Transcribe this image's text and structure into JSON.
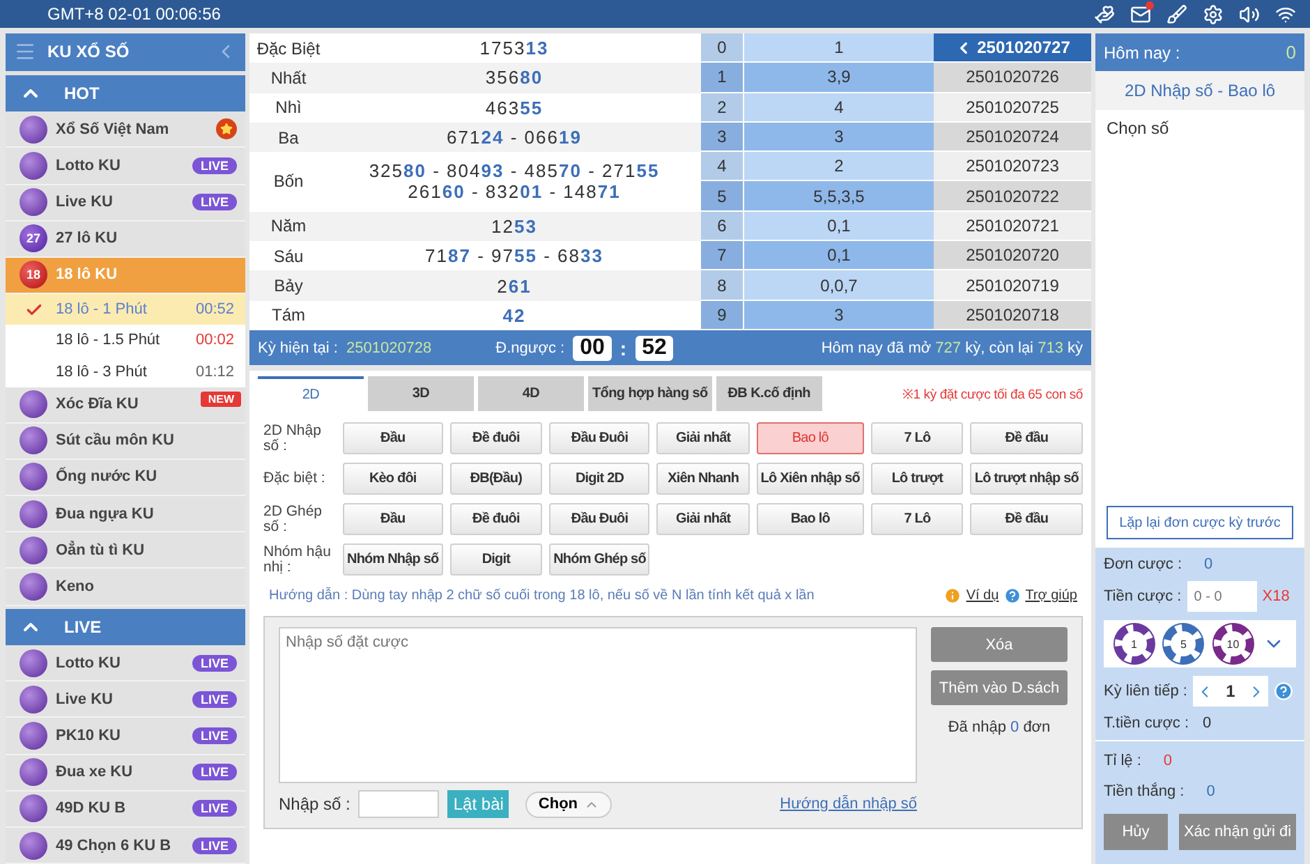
{
  "topbar": {
    "clock": "GMT+8 02-01 00:06:56",
    "mail_unread": true
  },
  "sidebar": {
    "title": "KU XỔ SỐ",
    "sections": [
      {
        "title": "HOT",
        "expanded": true,
        "items": [
          {
            "label": "Xổ Số Việt Nam",
            "starred": true,
            "selected": false
          },
          {
            "label": "Lotto KU",
            "badge": "LIVE",
            "selected": false
          },
          {
            "label": "Live KU",
            "badge": "LIVE",
            "selected": false
          },
          {
            "label": "27 lô KU",
            "icon_text": "27",
            "selected": false
          },
          {
            "label": "18 lô KU",
            "icon_text": "18",
            "selected": true,
            "expanded": true,
            "children": [
              {
                "label": "18 lô - 1 Phút",
                "time": "00:52",
                "color": "#5b7fd0",
                "selected": true
              },
              {
                "label": "18 lô - 1.5 Phút",
                "time": "00:02",
                "color": "#e53935",
                "selected": false
              },
              {
                "label": "18 lô - 3 Phút",
                "time": "01:12",
                "color": "#666666",
                "selected": false
              }
            ]
          },
          {
            "label": "Xóc Đĩa KU",
            "ribbon": "NEW",
            "selected": false
          },
          {
            "label": "Sút cầu môn KU",
            "selected": false
          },
          {
            "label": "Ống nước KU",
            "selected": false
          },
          {
            "label": "Đua ngựa KU",
            "selected": false
          },
          {
            "label": "Oẳn tù tì KU",
            "selected": false
          },
          {
            "label": "Keno",
            "selected": false
          }
        ]
      },
      {
        "title": "LIVE",
        "expanded": true,
        "items": [
          {
            "label": "Lotto KU",
            "badge": "LIVE",
            "selected": false
          },
          {
            "label": "Live KU",
            "badge": "LIVE",
            "selected": false
          },
          {
            "label": "PK10 KU",
            "badge": "LIVE",
            "selected": false
          },
          {
            "label": "Đua xe KU",
            "badge": "LIVE",
            "selected": false
          },
          {
            "label": "49D KU B",
            "badge": "LIVE",
            "selected": false
          },
          {
            "label": "49 Chọn 6 KU B",
            "badge": "LIVE",
            "selected": false
          }
        ]
      }
    ]
  },
  "results": {
    "prizes": [
      {
        "name": "Đặc Biệt",
        "lines": [
          [
            {
              "head": "1753",
              "tail": "13"
            }
          ]
        ]
      },
      {
        "name": "Nhất",
        "lines": [
          [
            {
              "head": "356",
              "tail": "80"
            }
          ]
        ]
      },
      {
        "name": "Nhì",
        "lines": [
          [
            {
              "head": "463",
              "tail": "55"
            }
          ]
        ]
      },
      {
        "name": "Ba",
        "lines": [
          [
            {
              "head": "671",
              "tail": "24"
            },
            {
              "head": "066",
              "tail": "19"
            }
          ]
        ]
      },
      {
        "name": "Bốn",
        "lines": [
          [
            {
              "head": "325",
              "tail": "80"
            },
            {
              "head": "804",
              "tail": "93"
            },
            {
              "head": "485",
              "tail": "70"
            },
            {
              "head": "271",
              "tail": "55"
            }
          ],
          [
            {
              "head": "261",
              "tail": "60"
            },
            {
              "head": "832",
              "tail": "01"
            },
            {
              "head": "148",
              "tail": "71"
            }
          ]
        ]
      },
      {
        "name": "Năm",
        "lines": [
          [
            {
              "head": "12",
              "tail": "53"
            }
          ]
        ]
      },
      {
        "name": "Sáu",
        "lines": [
          [
            {
              "head": "71",
              "tail": "87"
            },
            {
              "head": "97",
              "tail": "55"
            },
            {
              "head": "68",
              "tail": "33"
            }
          ]
        ]
      },
      {
        "name": "Bảy",
        "lines": [
          [
            {
              "head": "2",
              "tail": "61"
            }
          ]
        ]
      },
      {
        "name": "Tám",
        "lines": [
          [
            {
              "tail": "42"
            }
          ]
        ]
      }
    ],
    "separator": "-",
    "digits": [
      {
        "digit": "0",
        "values": "1"
      },
      {
        "digit": "1",
        "values": "3,9"
      },
      {
        "digit": "2",
        "values": "4"
      },
      {
        "digit": "3",
        "values": "3"
      },
      {
        "digit": "4",
        "values": "2"
      },
      {
        "digit": "5",
        "values": "5,5,3,5"
      },
      {
        "digit": "6",
        "values": "0,1"
      },
      {
        "digit": "7",
        "values": "0,1"
      },
      {
        "digit": "8",
        "values": "0,0,7"
      },
      {
        "digit": "9",
        "values": "3"
      }
    ],
    "periods": [
      {
        "label": "2501020727",
        "selected": true
      },
      {
        "label": "2501020726",
        "selected": false
      },
      {
        "label": "2501020725",
        "selected": false
      },
      {
        "label": "2501020724",
        "selected": false
      },
      {
        "label": "2501020723",
        "selected": false
      },
      {
        "label": "2501020722",
        "selected": false
      },
      {
        "label": "2501020721",
        "selected": false
      },
      {
        "label": "2501020720",
        "selected": false
      },
      {
        "label": "2501020719",
        "selected": false
      },
      {
        "label": "2501020718",
        "selected": false
      }
    ],
    "status": {
      "current_label": "Kỳ hiện tại  :",
      "current": "2501020728",
      "countdown_label": "Đ.ngược :",
      "minutes": "00",
      "colon": ":",
      "seconds": "52",
      "today_prefix": "Hôm nay đã mở",
      "opened": "727",
      "mid": "kỳ, còn lại",
      "remaining": "713",
      "suffix": "kỳ"
    }
  },
  "bet": {
    "tabs": [
      {
        "label": "2D",
        "selected": true
      },
      {
        "label": "3D",
        "selected": false
      },
      {
        "label": "4D",
        "selected": false
      },
      {
        "label": "Tổng hợp hàng số",
        "selected": false
      },
      {
        "label": "ĐB K.cố định",
        "selected": false
      }
    ],
    "notice": "※1 kỳ đặt cược tối đa 65 con số",
    "rows": [
      {
        "label": "2D Nhập số :",
        "buttons": [
          {
            "label": "Đầu",
            "selected": false
          },
          {
            "label": "Đề đuôi",
            "selected": false
          },
          {
            "label": "Đầu Đuôi",
            "selected": false
          },
          {
            "label": "Giải nhất",
            "selected": false
          },
          {
            "label": "Bao lô",
            "selected": true
          },
          {
            "label": "7 Lô",
            "selected": false
          },
          {
            "label": "Đề đầu",
            "selected": false
          }
        ]
      },
      {
        "label": "Đặc biệt :",
        "buttons": [
          {
            "label": "Kèo đôi",
            "selected": false
          },
          {
            "label": "ĐB(Đầu)",
            "selected": false
          },
          {
            "label": "Digit 2D",
            "selected": false
          },
          {
            "label": "Xiên Nhanh",
            "selected": false
          },
          {
            "label": "Lô Xiên nhập số",
            "selected": false
          },
          {
            "label": "Lô trượt",
            "selected": false
          },
          {
            "label": "Lô trượt nhập số",
            "selected": false
          }
        ]
      },
      {
        "label": "2D Ghép số :",
        "buttons": [
          {
            "label": "Đầu",
            "selected": false
          },
          {
            "label": "Đề đuôi",
            "selected": false
          },
          {
            "label": "Đầu Đuôi",
            "selected": false
          },
          {
            "label": "Giải nhất",
            "selected": false
          },
          {
            "label": "Bao lô",
            "selected": false
          },
          {
            "label": "7 Lô",
            "selected": false
          },
          {
            "label": "Đề đầu",
            "selected": false
          }
        ]
      },
      {
        "label": "Nhóm hậu nhị :",
        "buttons": [
          {
            "label": "Nhóm Nhập số",
            "selected": false
          },
          {
            "label": "Digit",
            "selected": false
          },
          {
            "label": "Nhóm Ghép số",
            "selected": false
          }
        ]
      }
    ],
    "guide": "Hướng dẫn : Dùng tay nhập 2 chữ số cuối trong 18 lô, nếu số về N lần tính kết quả x lần",
    "example_link": "Ví dụ",
    "help_link": "Trợ giúp",
    "entry": {
      "placeholder": "Nhập số đặt cược",
      "number_label": "Nhập số :",
      "flip_button": "Lật bài",
      "choose": "Chọn",
      "guide_link": "Hướng dẫn nhập số",
      "clear_button": "Xóa",
      "add_button": "Thêm vào D.sách",
      "entered_prefix": "Đã nhập",
      "entered": "0",
      "entered_suffix": "đơn"
    }
  },
  "slip": {
    "today_label": "Hôm nay :",
    "today": "0",
    "title": "2D Nhập số - Bao lô",
    "picked_label": "Chọn số",
    "repeat_button": "Lặp lại đơn cược kỳ trước",
    "orders_label": "Đơn cược :",
    "orders": "0",
    "stake_label": "Tiền cược :",
    "stake_placeholder": "0 - 0",
    "multiplier": "X18",
    "chips": [
      "1",
      "5",
      "10"
    ],
    "streak_label": "Kỳ liên tiếp :",
    "streak": "1",
    "total_label": "T.tiền cược :",
    "total": "0",
    "rate_label": "Tỉ lệ :",
    "rate": "0",
    "win_label": "Tiền thắng :",
    "win": "0",
    "cancel_button": "Hủy",
    "confirm_button": "Xác nhận gửi đi"
  }
}
